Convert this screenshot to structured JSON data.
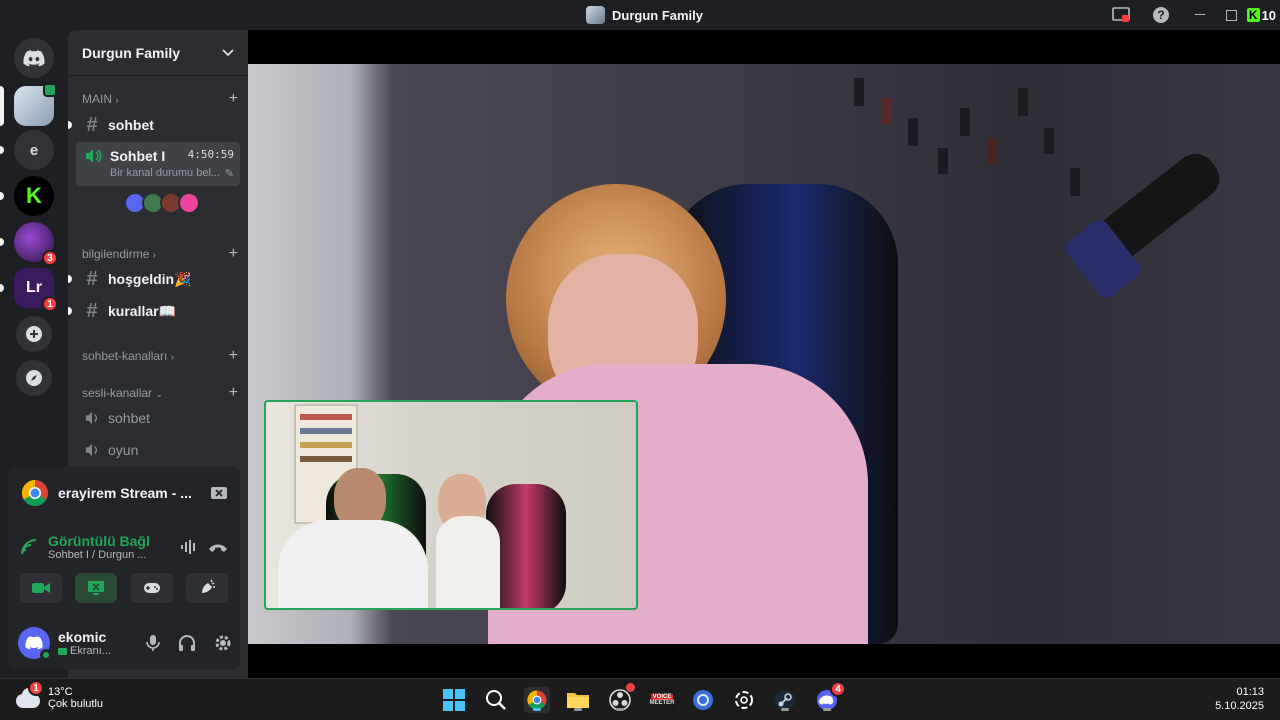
{
  "window": {
    "title": "Durgun Family"
  },
  "titlebar_right": {
    "app_badge": "10"
  },
  "guilds": [
    {
      "name": "discord-home",
      "label": ""
    },
    {
      "name": "durgun-family",
      "label": ""
    },
    {
      "name": "e-server",
      "label": "e"
    },
    {
      "name": "kick-server",
      "label": "K"
    },
    {
      "name": "purple-server",
      "label": "",
      "badge": "3"
    },
    {
      "name": "lr-server",
      "label": "",
      "badge": "1"
    }
  ],
  "server": {
    "name": "Durgun Family"
  },
  "categories": {
    "main": "MAIN",
    "bilgilendirme": "bilgilendirme",
    "sohbet_kanallari": "sohbet-kanalları",
    "sesli_kanallar": "sesli-kanallar"
  },
  "channels": {
    "sohbet": "sohbet",
    "active_voice": {
      "name": "Sohbet I",
      "timer": "4:50:59",
      "status": "Bir kanal durumu bel..."
    },
    "hosgeldin": "hoşgeldin🎉",
    "kurallar": "kurallar📖",
    "voice_sohbet": "sohbet",
    "voice_oyun": "oyun"
  },
  "stream": {
    "title": "erayirem Stream - ..."
  },
  "voice_status": {
    "title": "Görüntülü Bağl",
    "subtitle": "Sohbet I / Durgun ..."
  },
  "user": {
    "name": "ekomic",
    "status": "Ekranı..."
  },
  "taskbar": {
    "weather_temp": "13°C",
    "weather_desc": "Çok bulutlu",
    "weather_badge": "1",
    "time": "01:13",
    "date": "5.10.2025",
    "discord_badge": "4",
    "voicemeeter_top": "VOICE",
    "voicemeeter_bottom": "MEETER"
  },
  "colors": {
    "accent": "#5865f2",
    "green": "#23a55a",
    "red": "#f23f43",
    "kick_green": "#53fc18"
  }
}
